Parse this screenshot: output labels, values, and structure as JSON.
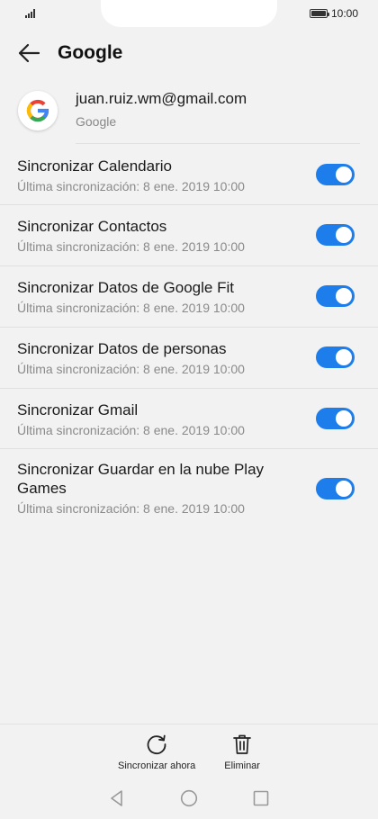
{
  "status_bar": {
    "time": "10:00"
  },
  "app_bar": {
    "title": "Google"
  },
  "account": {
    "email": "juan.ruiz.wm@gmail.com",
    "provider": "Google"
  },
  "sync_items": [
    {
      "title": "Sincronizar Calendario",
      "subtitle": "Última sincronización: 8 ene. 2019 10:00",
      "enabled": true
    },
    {
      "title": "Sincronizar Contactos",
      "subtitle": "Última sincronización: 8 ene. 2019 10:00",
      "enabled": true
    },
    {
      "title": "Sincronizar Datos de Google Fit",
      "subtitle": "Última sincronización: 8 ene. 2019 10:00",
      "enabled": true
    },
    {
      "title": "Sincronizar Datos de personas",
      "subtitle": "Última sincronización: 8 ene. 2019 10:00",
      "enabled": true
    },
    {
      "title": "Sincronizar Gmail",
      "subtitle": "Última sincronización: 8 ene. 2019 10:00",
      "enabled": true
    },
    {
      "title": "Sincronizar Guardar en la nube Play Games",
      "subtitle": "Última sincronización: 8 ene. 2019 10:00",
      "enabled": true
    }
  ],
  "bottom_actions": {
    "sync_now": {
      "label": "Sincronizar ahora",
      "icon": "sync-icon"
    },
    "delete": {
      "label": "Eliminar",
      "icon": "trash-icon"
    }
  },
  "colors": {
    "accent": "#1d7eeb",
    "background": "#f2f2f2"
  }
}
